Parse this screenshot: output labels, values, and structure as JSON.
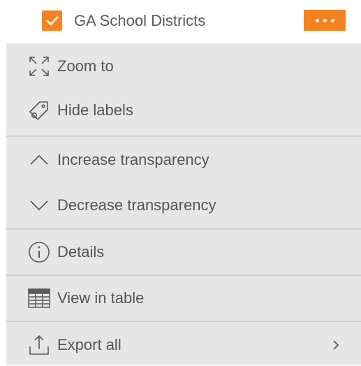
{
  "layer": {
    "title": "GA School Districts",
    "checked": true,
    "accent_color": "#f58220"
  },
  "menu": {
    "items": [
      {
        "label": "Zoom to",
        "icon": "zoom-to-icon"
      },
      {
        "label": "Hide labels",
        "icon": "tag-icon"
      },
      {
        "label": "Increase transparency",
        "icon": "chevron-up-icon"
      },
      {
        "label": "Decrease transparency",
        "icon": "chevron-down-icon"
      },
      {
        "label": "Details",
        "icon": "info-icon"
      },
      {
        "label": "View in table",
        "icon": "table-icon"
      },
      {
        "label": "Export all",
        "icon": "export-icon",
        "submenu": true
      }
    ]
  }
}
